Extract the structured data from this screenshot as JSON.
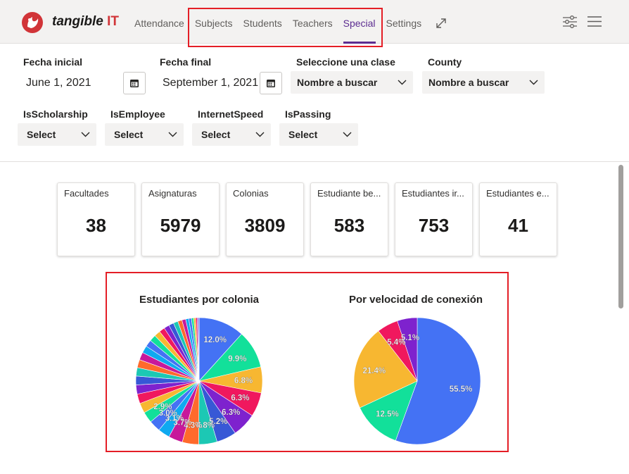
{
  "app": {
    "brand_name": "tangible",
    "brand_suffix": "IT"
  },
  "nav": {
    "items": [
      {
        "label": "Attendance",
        "active": false
      },
      {
        "label": "Subjects",
        "active": false
      },
      {
        "label": "Students",
        "active": false
      },
      {
        "label": "Teachers",
        "active": false
      },
      {
        "label": "Special",
        "active": true
      },
      {
        "label": "Settings",
        "active": false
      }
    ],
    "icons": [
      "expand-icon",
      "filter-settings-icon",
      "hamburger-menu-icon"
    ]
  },
  "filters": {
    "start_date": {
      "label": "Fecha inicial",
      "value": "June 1, 2021"
    },
    "end_date": {
      "label": "Fecha final",
      "value": "September 1, 2021"
    },
    "class_select": {
      "label": "Seleccione una clase",
      "value": "Nombre a buscar"
    },
    "county": {
      "label": "County",
      "value": "Nombre a buscar"
    },
    "is_scholarship": {
      "label": "IsScholarship",
      "value": "Select"
    },
    "is_employee": {
      "label": "IsEmployee",
      "value": "Select"
    },
    "internet_speed": {
      "label": "InternetSpeed",
      "value": "Select"
    },
    "is_passing": {
      "label": "IsPassing",
      "value": "Select"
    }
  },
  "cards": [
    {
      "title": "Facultades",
      "value": "38"
    },
    {
      "title": "Asignaturas",
      "value": "5979"
    },
    {
      "title": "Colonias",
      "value": "3809"
    },
    {
      "title": "Estudiante be...",
      "value": "583"
    },
    {
      "title": "Estudiantes ir...",
      "value": "753"
    },
    {
      "title": "Estudiantes e...",
      "value": "41"
    }
  ],
  "colors": {
    "accent": "#5c2d91",
    "highlight_box": "#e41e26",
    "pie_palette": [
      "#4472f4",
      "#12e09a",
      "#f7b731",
      "#f0185e",
      "#7e22ce",
      "#3758d6",
      "#1cc8b4",
      "#ff6a2c",
      "#c7199b",
      "#0fa9f0"
    ]
  },
  "chart_data": [
    {
      "type": "pie",
      "title": "Estudiantes por colonia",
      "slices": [
        {
          "label": "12.0%",
          "value": 12.0
        },
        {
          "label": "9.9%",
          "value": 9.9
        },
        {
          "label": "6.8%",
          "value": 6.8
        },
        {
          "label": "6.3%",
          "value": 6.3
        },
        {
          "label": "6.3%",
          "value": 6.3
        },
        {
          "label": "5.2%",
          "value": 5.2
        },
        {
          "label": "4.8%",
          "value": 4.8
        },
        {
          "label": "4.3%",
          "value": 4.3
        },
        {
          "label": "3.7%",
          "value": 3.7
        },
        {
          "label": "3.1%",
          "value": 3.1
        },
        {
          "label": "3.0%",
          "value": 3.0
        },
        {
          "label": "2.9%",
          "value": 2.9
        },
        {
          "label": "",
          "value": 2.6
        },
        {
          "label": "",
          "value": 2.5
        },
        {
          "label": "",
          "value": 2.4
        },
        {
          "label": "",
          "value": 2.3
        },
        {
          "label": "",
          "value": 2.2
        },
        {
          "label": "",
          "value": 2.1
        },
        {
          "label": "",
          "value": 2.0
        },
        {
          "label": "",
          "value": 1.9
        },
        {
          "label": "",
          "value": 1.8
        },
        {
          "label": "",
          "value": 1.7
        },
        {
          "label": "",
          "value": 1.6
        },
        {
          "label": "",
          "value": 1.5
        },
        {
          "label": "",
          "value": 1.4
        },
        {
          "label": "",
          "value": 1.3
        },
        {
          "label": "",
          "value": 1.2
        },
        {
          "label": "",
          "value": 1.1
        },
        {
          "label": "",
          "value": 1.0
        },
        {
          "label": "",
          "value": 0.8
        },
        {
          "label": "",
          "value": 0.7
        },
        {
          "label": "",
          "value": 0.6
        },
        {
          "label": "",
          "value": 0.5
        },
        {
          "label": "",
          "value": 0.4
        },
        {
          "label": "",
          "value": 0.3
        },
        {
          "label": "",
          "value": 0.2
        }
      ]
    },
    {
      "type": "pie",
      "title": "Por velocidad de conexión",
      "slices": [
        {
          "label": "55.5%",
          "value": 55.5,
          "color": "#4472f4"
        },
        {
          "label": "12.5%",
          "value": 12.5,
          "color": "#12e09a"
        },
        {
          "label": "21.4%",
          "value": 21.4,
          "color": "#f7b731"
        },
        {
          "label": "5.4%",
          "value": 5.4,
          "color": "#f0185e"
        },
        {
          "label": "5.1%",
          "value": 5.1,
          "color": "#7e22ce"
        }
      ]
    }
  ]
}
